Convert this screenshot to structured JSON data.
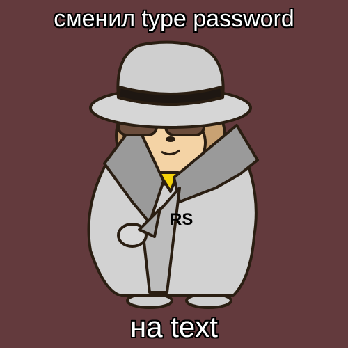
{
  "meme": {
    "top_text": "сменил type password",
    "bottom_text": "на text",
    "coat_badge": "RS"
  },
  "colors": {
    "background": "#633a3d",
    "coat": "#d2d2d2",
    "fur": "#c9a273"
  }
}
